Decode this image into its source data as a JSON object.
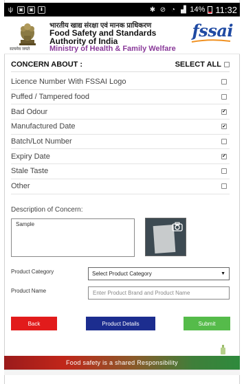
{
  "status_bar": {
    "time": "11:32",
    "battery": "14%",
    "icons": [
      "usb-icon",
      "image-icon",
      "image-icon",
      "download-icon",
      "bluetooth-icon",
      "mute-icon",
      "wifi-icon",
      "signal-icon",
      "battery-icon"
    ]
  },
  "header": {
    "hindi_line": "भारतीय खाद्य संरक्षा एवं मानक प्राधिकरण",
    "title_line1": "Food Safety and Standards",
    "title_line2": "Authority of India",
    "ministry": "Ministry of Health & Family Welfare",
    "emblem_caption": "सत्यमेव जयते",
    "logo_text": "fssai"
  },
  "concern": {
    "title": "CONCERN ABOUT :",
    "select_all_label": "SELECT ALL",
    "select_all_checked": false,
    "items": [
      {
        "label": "Licence Number With FSSAI Logo",
        "checked": false
      },
      {
        "label": "Puffed / Tampered food",
        "checked": false
      },
      {
        "label": "Bad Odour",
        "checked": true
      },
      {
        "label": "Manufactured Date",
        "checked": true
      },
      {
        "label": "Batch/Lot Number",
        "checked": false
      },
      {
        "label": "Expiry Date",
        "checked": true
      },
      {
        "label": "Stale Taste",
        "checked": false
      },
      {
        "label": "Other",
        "checked": false
      }
    ]
  },
  "description": {
    "label": "Description of Concern:",
    "value": "Sample"
  },
  "product": {
    "category_label": "Product Category",
    "category_selected": "Select Product Category",
    "name_label": "Product Name",
    "name_placeholder": "Enter Product Brand and Product Name",
    "name_value": ""
  },
  "buttons": {
    "back": "Back",
    "details": "Product Details",
    "submit": "Submit"
  },
  "footer": {
    "tagline": "Food safety is a shared Responsibility"
  },
  "colors": {
    "back_button": "#e21b1b",
    "details_button": "#1c2d8f",
    "submit_button": "#55bb4a",
    "ministry_text": "#8a3a9a",
    "logo": "#1f4aa3"
  }
}
